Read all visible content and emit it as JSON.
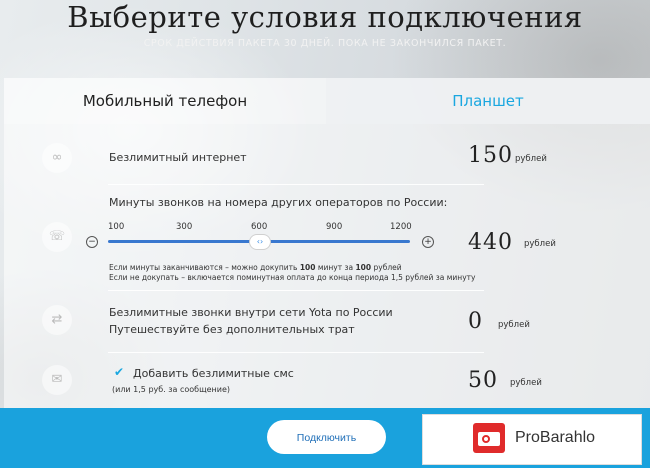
{
  "header": {
    "title": "Выберите условия подключения",
    "subtitle": "СРОК ДЕЙСТВИЯ ПАКЕТА 30 ДНЕЙ. ПОКА НЕ ЗАКОНЧИЛСЯ ПАКЕТ."
  },
  "tabs": [
    {
      "label": "Мобильный телефон",
      "active": true
    },
    {
      "label": "Планшет",
      "active": false
    }
  ],
  "rows": {
    "internet": {
      "label": "Безлимитный интернет",
      "price": "150",
      "currency": "рублей",
      "icon": "infinity-icon"
    },
    "minutes": {
      "label": "Минуты звонков на номера других операторов по России:",
      "ticks": [
        "100",
        "300",
        "600",
        "900",
        "1200"
      ],
      "selected": "600",
      "price": "440",
      "currency": "рублей",
      "icon": "phone-icon",
      "note1_prefix": "Если минуты заканчиваются – можно докупить ",
      "note1_a": "100",
      "note1_mid": " минут за ",
      "note1_b": "100",
      "note1_suffix": " рублей",
      "note2": "Если не докупать – включается поминутная оплата до конца периода 1,5 рублей за минуту"
    },
    "yota": {
      "line1": "Безлимитные звонки внутри сети Yota по России",
      "line2": "Путешествуйте без дополнительных трат",
      "price": "0",
      "currency": "рублей",
      "icon": "arrows-icon"
    },
    "sms": {
      "label": "Добавить безлимитные смс",
      "sub": "(или 1,5 руб. за сообщение)",
      "price": "50",
      "currency": "рублей",
      "checked": true,
      "icon": "message-icon"
    }
  },
  "footer": {
    "connect_label": "Подключить",
    "badge_text": "ProBarahlo"
  },
  "colors": {
    "accent": "#1aa2dd",
    "slider": "#3978cf",
    "badge_red": "#e02b2b"
  }
}
